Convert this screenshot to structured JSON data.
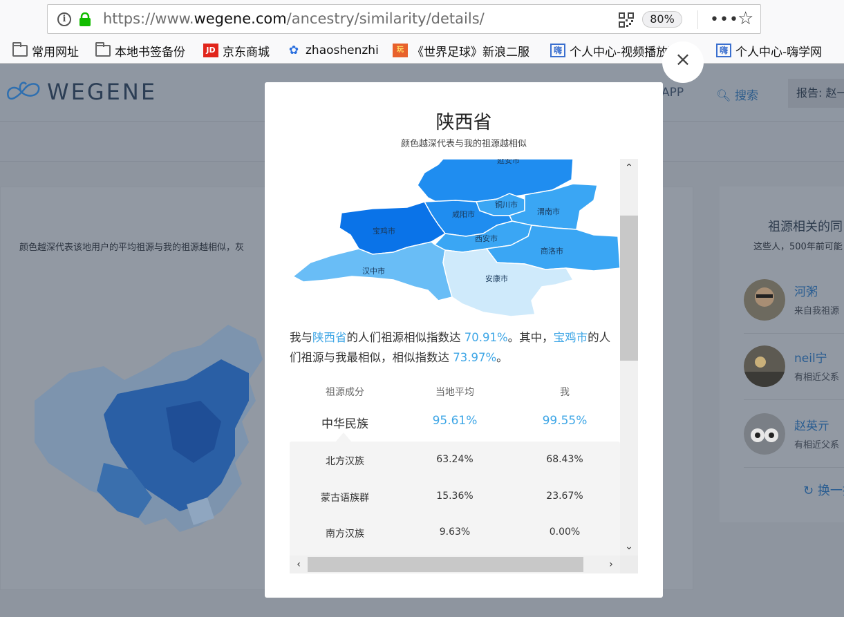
{
  "browser": {
    "url_prefix": "https://www.",
    "url_domain": "wegene.com",
    "url_path": "/ancestry/similarity/details/",
    "zoom": "80%",
    "bookmarks": [
      {
        "label": "常用网址",
        "icon": "folder-icon"
      },
      {
        "label": "本地书签备份",
        "icon": "folder-icon"
      },
      {
        "label": "京东商城",
        "icon": "jd-icon"
      },
      {
        "label": "zhaoshenzhi",
        "icon": "paw-icon"
      },
      {
        "label": "《世界足球》新浪二服",
        "icon": "wan-icon"
      },
      {
        "label": "个人中心-视频播放页...",
        "icon": "hai-icon"
      },
      {
        "label": "个人中心-嗨学网",
        "icon": "hai-icon"
      }
    ]
  },
  "site": {
    "logo": "WEGENE",
    "nav_app": "APP",
    "nav_search": "搜索",
    "nav_report": "报告: 赵一",
    "left_desc": "颜色越深代表该地用户的平均祖源与我的祖源越相似，灰",
    "right_title": "祖源相关的同",
    "right_sub": "这些人，500年前可能",
    "users": [
      {
        "name": "河粥",
        "desc": "来自我祖源"
      },
      {
        "name": "neil宁",
        "desc": "有相近父系"
      },
      {
        "name": "赵英亓",
        "desc": "有相近父系"
      }
    ],
    "refresh": "换一批"
  },
  "modal": {
    "title": "陕西省",
    "subtitle": "颜色越深代表与我的祖源越相似",
    "cities": [
      "延安市",
      "铜川市",
      "渭南市",
      "咸阳市",
      "宝鸡市",
      "西安市",
      "商洛市",
      "汉中市",
      "安康市"
    ],
    "summary": {
      "p1": "我与",
      "province": "陕西省",
      "p2": "的人们祖源相似指数达",
      "province_index": "70.91%",
      "p3": "。其中，",
      "city": "宝鸡市",
      "p4": "的人们祖源与我最相似，相似指数达",
      "city_index": "73.97%",
      "p5": "。"
    },
    "table": {
      "headers": [
        "祖源成分",
        "当地平均",
        "我"
      ],
      "main": {
        "label": "中华民族",
        "local": "95.61%",
        "me": "99.55%"
      },
      "rows": [
        {
          "label": "北方汉族",
          "local": "63.24%",
          "me": "68.43%"
        },
        {
          "label": "蒙古语族群",
          "local": "15.36%",
          "me": "23.67%"
        },
        {
          "label": "南方汉族",
          "local": "9.63%",
          "me": "0.00%"
        }
      ]
    }
  },
  "colors": {
    "accent": "#3ea6e6",
    "map_darkest": "#0a73e8",
    "map_dark": "#1f8df0",
    "map_mid": "#3aa6f4",
    "map_light": "#69bdf6",
    "map_lightest": "#cfeafb"
  }
}
